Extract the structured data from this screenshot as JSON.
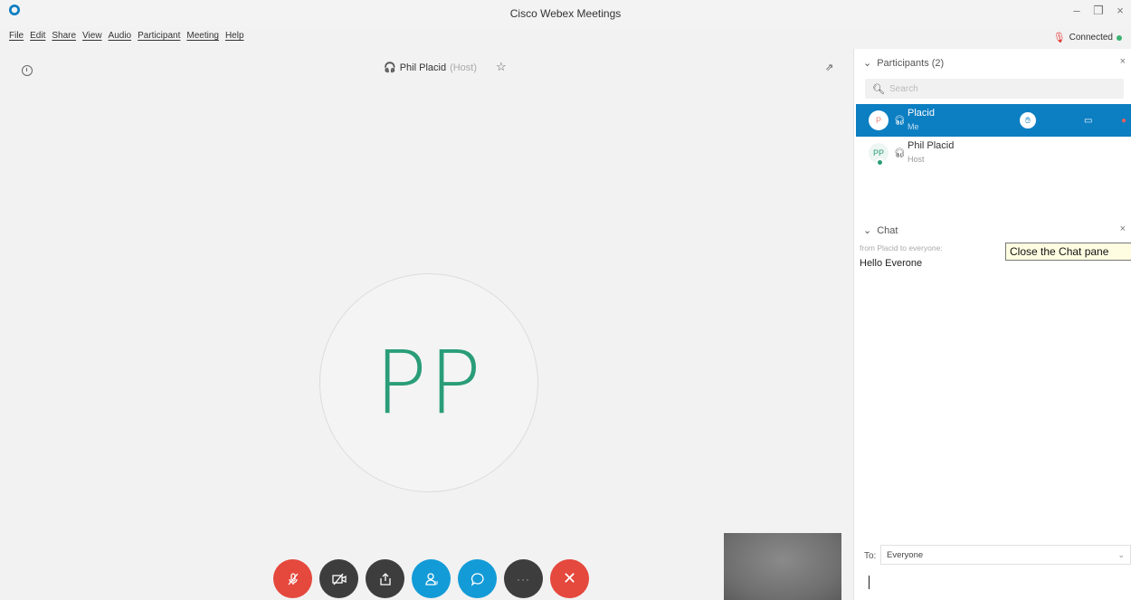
{
  "window": {
    "title": "Cisco Webex Meetings"
  },
  "menu": {
    "items": [
      "File",
      "Edit",
      "Share",
      "View",
      "Audio",
      "Participant",
      "Meeting",
      "Help"
    ]
  },
  "status": {
    "connection": "Connected"
  },
  "stage": {
    "speaker_name": "Phil Placid",
    "speaker_role": "(Host)",
    "avatar_initials": "PP"
  },
  "participants": {
    "header": "Participants (2)",
    "search_placeholder": "Search",
    "list": [
      {
        "initial": "P",
        "name": "Placid",
        "role": "Me",
        "selected": true
      },
      {
        "initial": "PP",
        "name": "Phil Placid",
        "role": "Host",
        "selected": false
      }
    ]
  },
  "chat": {
    "header": "Chat",
    "from": "from Placid to everyone:",
    "message": "Hello Everone",
    "tooltip": "Close the Chat pane",
    "to_label": "To:",
    "to_value": "Everyone"
  },
  "colors": {
    "accent": "#0c7ec2",
    "avatar_green": "#2a9d78",
    "end_red": "#e5483d",
    "button_blue": "#139bd7"
  }
}
